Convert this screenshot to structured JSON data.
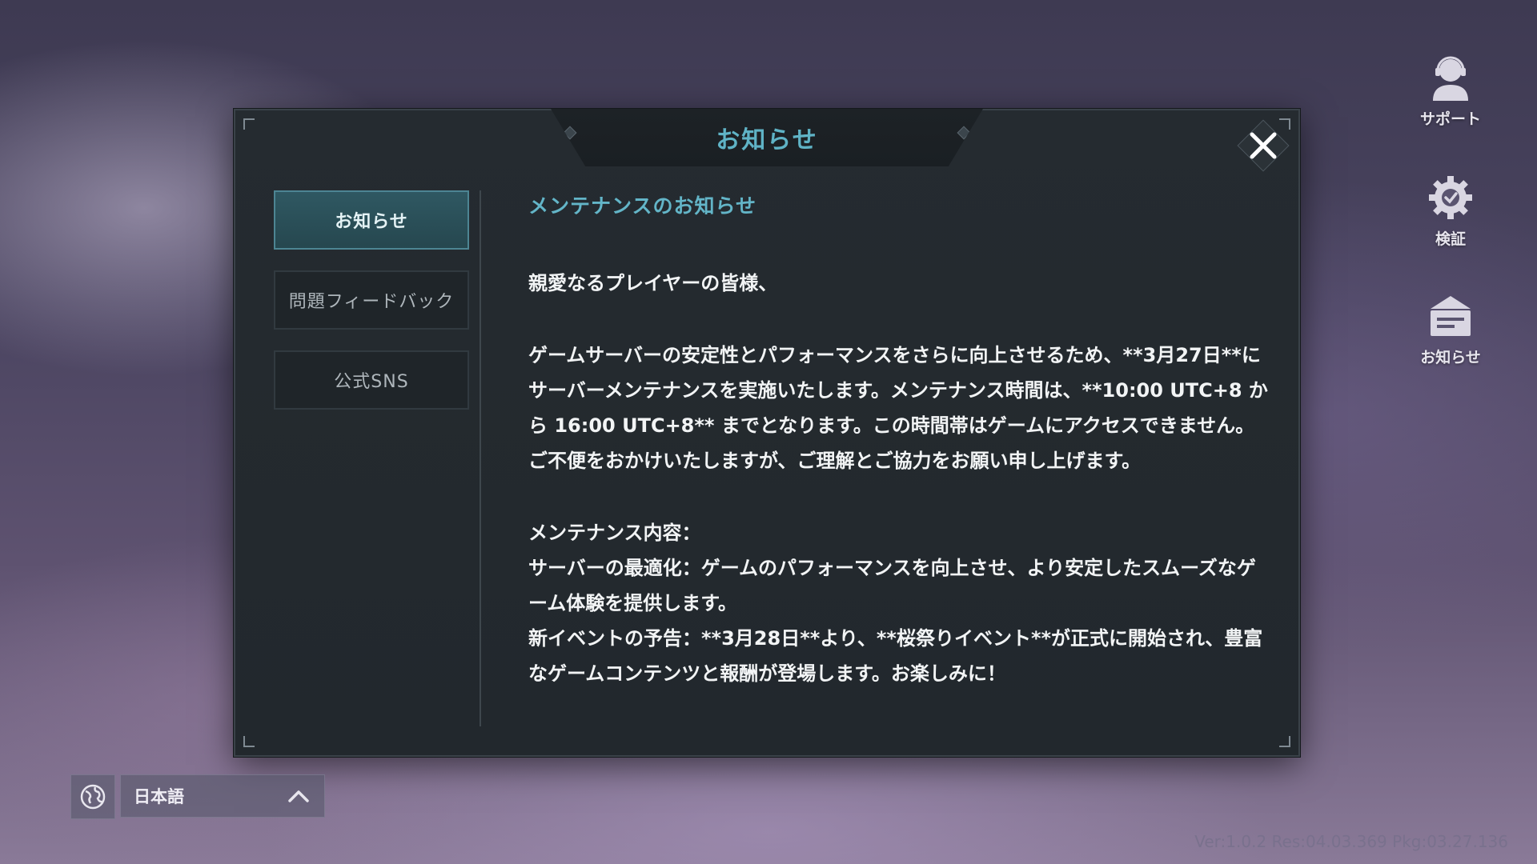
{
  "dialog": {
    "title": "お知らせ",
    "close_icon": "close-icon"
  },
  "tabs": [
    {
      "label": "お知らせ",
      "active": true
    },
    {
      "label": "問題フィードバック",
      "active": false
    },
    {
      "label": "公式SNS",
      "active": false
    }
  ],
  "notice": {
    "heading": "メンテナンスのお知らせ",
    "greeting": "親愛なるプレイヤーの皆様、",
    "body": "ゲームサーバーの安定性とパフォーマンスをさらに向上させるため、**3月27日**にサーバーメンテナンスを実施いたします。メンテナンス時間は、**10:00 UTC+8 から 16:00 UTC+8** までとなります。この時間帯はゲームにアクセスできません。ご不便をおかけいたしますが、ご理解とご協力をお願い申し上げます。",
    "section_title": "メンテナンス内容：",
    "item_1": "サーバーの最適化：ゲームのパフォーマンスを向上させ、より安定したスムーズなゲーム体験を提供します。",
    "item_2": "新イベントの予告：**3月28日**より、**桜祭りイベント**が正式に開始され、豊富なゲームコンテンツと報酬が登場します。お楽しみに！"
  },
  "side_menu": [
    {
      "label": "サポート",
      "icon": "support-agent-icon"
    },
    {
      "label": "検証",
      "icon": "gear-verify-icon"
    },
    {
      "label": "お知らせ",
      "icon": "mailbox-icon"
    }
  ],
  "language": {
    "icon": "globe-icon",
    "selected": "日本語",
    "chevron": "chevron-up-icon"
  },
  "version_text": "Ver:1.0.2 Res:04.03.369 Pkg:03.27.136",
  "colors": {
    "accent": "#5fb3c6",
    "panel_bg": "#232a2e",
    "active_tab": "#2f5862"
  }
}
